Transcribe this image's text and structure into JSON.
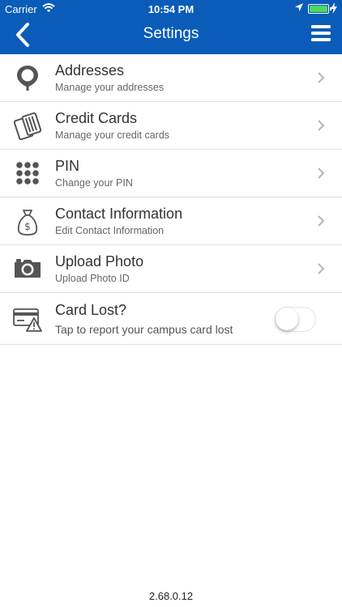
{
  "status_bar": {
    "carrier": "Carrier",
    "time": "10:54 PM"
  },
  "nav": {
    "title": "Settings"
  },
  "items": [
    {
      "label": "Addresses",
      "sub": "Manage your addresses"
    },
    {
      "label": "Credit Cards",
      "sub": "Manage your credit cards"
    },
    {
      "label": "PIN",
      "sub": "Change your PIN"
    },
    {
      "label": "Contact Information",
      "sub": "Edit Contact Information"
    },
    {
      "label": "Upload Photo",
      "sub": "Upload Photo ID"
    }
  ],
  "card_lost": {
    "label": "Card Lost?",
    "sub": "Tap to report your campus card lost",
    "toggle_on": false
  },
  "version": "2.68.0.12",
  "colors": {
    "nav_bar": "#0a5cb8",
    "icon_gray": "#555555"
  },
  "icons": [
    "map-pin-icon",
    "credit-cards-icon",
    "pin-keypad-icon",
    "money-bag-icon",
    "camera-icon",
    "card-warning-icon"
  ]
}
